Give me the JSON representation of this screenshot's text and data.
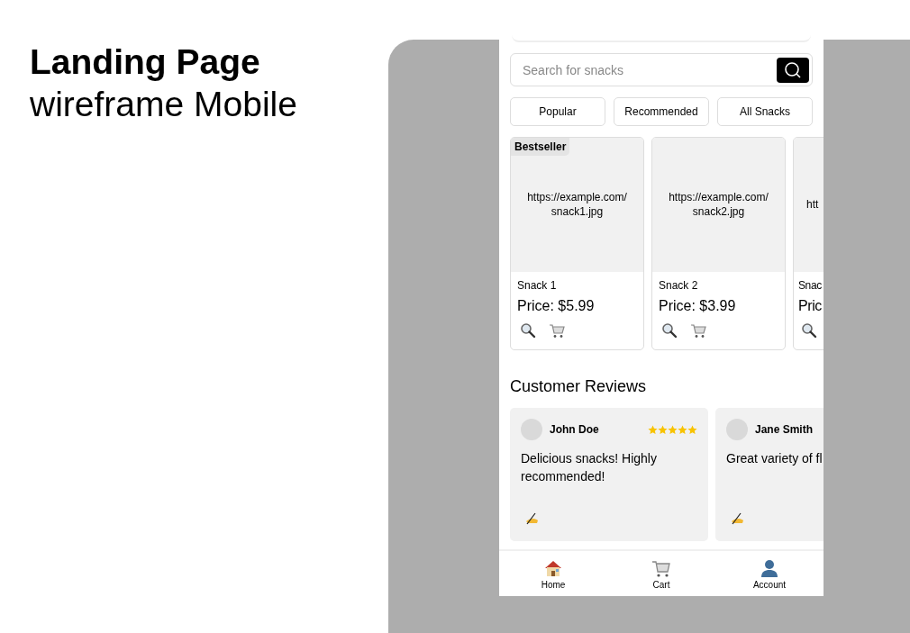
{
  "heading": {
    "title": "Landing Page",
    "subtitle": "wireframe Mobile"
  },
  "search": {
    "placeholder": "Search for snacks"
  },
  "filters": [
    {
      "label": "Popular"
    },
    {
      "label": "Recommended"
    },
    {
      "label": "All Snacks"
    }
  ],
  "products": [
    {
      "badge": "Bestseller",
      "image_text": "https://example.com/ snack1.jpg",
      "name": "Snack 1",
      "price": "Price: $5.99",
      "actions": [
        {
          "kind": "search"
        },
        {
          "kind": "cart"
        }
      ]
    },
    {
      "image_text": "https://example.com/ snack2.jpg",
      "name": "Snack 2",
      "price": "Price: $3.99",
      "actions": [
        {
          "kind": "search"
        },
        {
          "kind": "cart"
        }
      ]
    },
    {
      "image_text": "htt",
      "name": "Snac",
      "price": "Pric",
      "actions": [
        {
          "kind": "search"
        }
      ]
    }
  ],
  "reviews_title": "Customer Reviews",
  "reviews": [
    {
      "name": "John Doe",
      "stars": 5,
      "text": "Delicious snacks! Highly recommended!"
    },
    {
      "name": "Jane Smith",
      "text": "Great variety of fl"
    }
  ],
  "nav": [
    {
      "kind": "home",
      "label": "Home"
    },
    {
      "kind": "cart",
      "label": "Cart"
    },
    {
      "kind": "account",
      "label": "Account"
    }
  ]
}
